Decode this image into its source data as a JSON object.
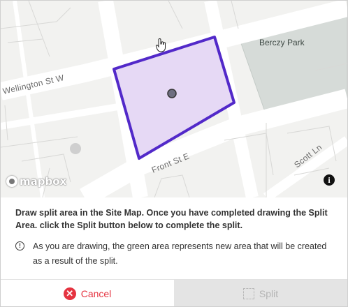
{
  "map": {
    "streets": {
      "wellington": "Wellington St W",
      "front": "Front St E",
      "scott": "Scott Ln"
    },
    "park_label": "Berczy Park",
    "attribution": "mapbox",
    "info_glyph": "i",
    "colors": {
      "polygon_fill": "#e6d9f5",
      "polygon_stroke": "#5229c9",
      "park": "#d6dbd8"
    }
  },
  "panel": {
    "instruction": "Draw split area in the Site Map. Once you have completed drawing the Split Area. click the Split button below to complete the split.",
    "note_icon": "!",
    "note": "As you are drawing, the green area represents new area that will be created as a result of the split."
  },
  "footer": {
    "cancel_label": "Cancel",
    "cancel_icon": "✕",
    "split_label": "Split"
  }
}
